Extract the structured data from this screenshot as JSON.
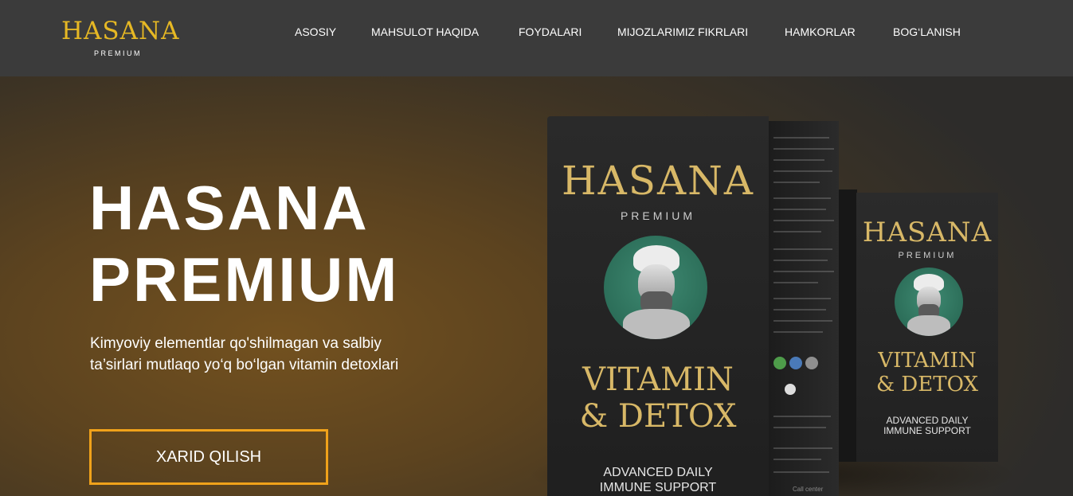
{
  "header": {
    "logo": {
      "main": "HASANA",
      "sub": "PREMIUM"
    },
    "nav": [
      {
        "label": "ASOSIY"
      },
      {
        "label": "MAHSULOT HAQIDA"
      },
      {
        "label": "FOYDALARI"
      },
      {
        "label": "MIJOZLARIMIZ FIKRLARI"
      },
      {
        "label": "HAMKORLAR"
      },
      {
        "label": "BOG‘LANISH"
      }
    ]
  },
  "hero": {
    "title_line1": "HASANA",
    "title_line2": "PREMIUM",
    "description": "Kimyoviy elementlar qo'shilmagan va salbiy ta’sirlari mutlaqo yo‘q bo‘lgan vitamin detoxlari",
    "cta_label": "XARID QILISH"
  },
  "product": {
    "brand": "HASANA",
    "brand_sub": "PREMIUM",
    "name_line1": "VITAMIN",
    "name_line2": "& DETOX",
    "tagline_line1": "ADVANCED DAILY",
    "tagline_line2": "IMMUNE SUPPORT",
    "side_call": "Call center"
  },
  "colors": {
    "header_bg": "#3b3b3b",
    "logo_gold": "#e6b824",
    "cta_border": "#f0a21a",
    "box_gold": "#d8b867",
    "portrait_green": "#2c6e59"
  }
}
